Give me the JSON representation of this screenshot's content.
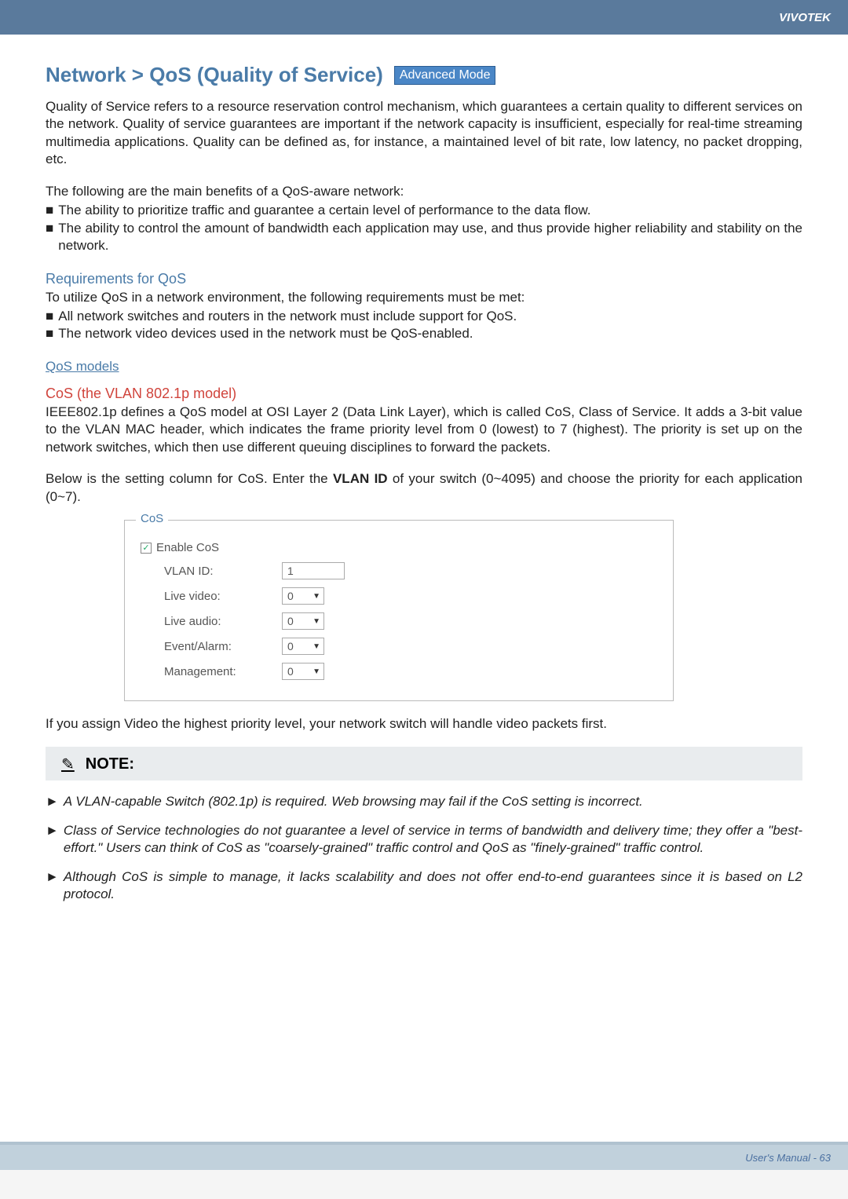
{
  "header": {
    "brand": "VIVOTEK"
  },
  "title": "Network > QoS (Quality of Service)",
  "mode_badge": "Advanced Mode",
  "intro": "Quality of Service refers to a resource reservation control mechanism, which guarantees a certain quality to different services on the network. Quality of service guarantees are important if the network capacity is insufficient, especially for real-time streaming multimedia applications. Quality can be defined as, for instance, a maintained level of bit rate, low latency, no packet dropping, etc.",
  "benefits_lead": "The following are the main benefits of a QoS-aware network:",
  "benefits": [
    "The ability to prioritize traffic and guarantee a certain level of performance to the data flow.",
    "The ability to control the amount of bandwidth each application may use, and thus provide higher reliability and stability on the network."
  ],
  "req_heading": "Requirements for QoS",
  "req_lead": "To utilize QoS in a network environment, the following requirements must be met:",
  "req_items": [
    "All network switches and routers in the network must include support for QoS.",
    "The network video devices used in the network must be QoS-enabled."
  ],
  "qos_models_heading": "QoS models",
  "cos_heading": "CoS (the VLAN 802.1p model)",
  "cos_para": "IEEE802.1p defines a QoS model at OSI Layer 2 (Data Link Layer), which is called CoS, Class of Service. It adds a 3-bit value to the VLAN MAC header, which indicates the frame priority level from 0 (lowest) to 7 (highest). The priority is set up on the network switches, which then use different queuing disciplines to forward the packets.",
  "cos_settings_pre": "Below is the setting column for CoS. Enter the ",
  "cos_settings_bold": "VLAN ID",
  "cos_settings_post": " of your switch (0~4095) and choose the priority for each application (0~7).",
  "cos_box": {
    "legend": "CoS",
    "enable_label": "Enable CoS",
    "enable_checked": "✓",
    "vlan_label": "VLAN ID:",
    "vlan_value": "1",
    "rows": {
      "live_video": {
        "label": "Live video:",
        "value": "0"
      },
      "live_audio": {
        "label": "Live audio:",
        "value": "0"
      },
      "event_alarm": {
        "label": "Event/Alarm:",
        "value": "0"
      },
      "management": {
        "label": "Management:",
        "value": "0"
      }
    }
  },
  "after_cos": "If you assign Video the highest priority level, your network switch will handle video packets first.",
  "note_heading": "NOTE:",
  "notes": [
    "A VLAN-capable Switch (802.1p) is required. Web browsing may fail if the CoS setting is incorrect.",
    "Class of Service technologies do not guarantee a level of service in terms of bandwidth and delivery time; they offer a \"best-effort.\" Users can think of CoS as \"coarsely-grained\" traffic control and QoS as \"finely-grained\" traffic control.",
    "Although CoS is simple to manage, it lacks scalability and does not offer end-to-end guarantees since it is based on L2 protocol."
  ],
  "footer": {
    "text": "User's Manual - 63"
  }
}
